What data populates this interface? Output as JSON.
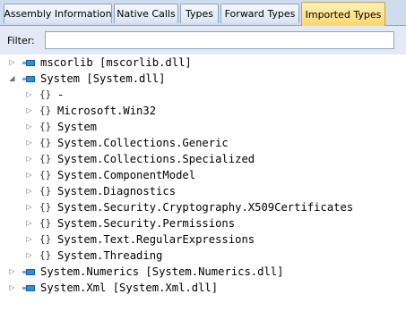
{
  "tabs": [
    {
      "label": "Assembly Information",
      "active": false
    },
    {
      "label": "Native Calls",
      "active": false
    },
    {
      "label": "Types",
      "active": false
    },
    {
      "label": "Forward Types",
      "active": false
    },
    {
      "label": "Imported Types",
      "active": true
    }
  ],
  "filter": {
    "label": "Filter:",
    "value": ""
  },
  "tree": {
    "assemblies": [
      {
        "label": "mscorlib [mscorlib.dll]",
        "expanded": false
      },
      {
        "label": "System [System.dll]",
        "expanded": true,
        "namespaces": [
          "-",
          "Microsoft.Win32",
          "System",
          "System.Collections.Generic",
          "System.Collections.Specialized",
          "System.ComponentModel",
          "System.Diagnostics",
          "System.Security.Cryptography.X509Certificates",
          "System.Security.Permissions",
          "System.Text.RegularExpressions",
          "System.Threading"
        ]
      },
      {
        "label": "System.Numerics [System.Numerics.dll]",
        "expanded": false
      },
      {
        "label": "System.Xml [System.Xml.dll]",
        "expanded": false
      }
    ],
    "namespace_icon": "{}",
    "expand_glyph": "▷",
    "collapse_glyph": "◢"
  },
  "colors": {
    "active_tab": "#ffd76e",
    "assembly_icon": "#2f8fd6",
    "background": "#cfdcee"
  }
}
